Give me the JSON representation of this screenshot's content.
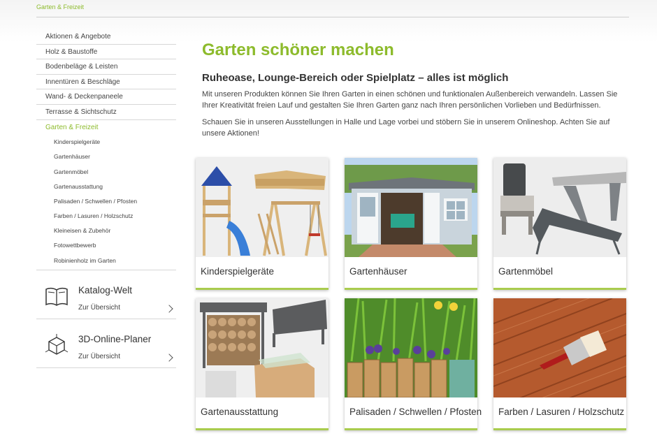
{
  "breadcrumb": "Garten & Freizeit",
  "sidebar": {
    "items": [
      {
        "label": "Aktionen & Angebote"
      },
      {
        "label": "Holz & Baustoffe"
      },
      {
        "label": "Bodenbeläge & Leisten"
      },
      {
        "label": "Innentüren & Beschläge"
      },
      {
        "label": "Wand- & Deckenpaneele"
      },
      {
        "label": "Terrasse & Sichtschutz"
      },
      {
        "label": "Garten & Freizeit"
      }
    ],
    "subitems": [
      {
        "label": "Kinderspielgeräte"
      },
      {
        "label": "Gartenhäuser"
      },
      {
        "label": "Gartenmöbel"
      },
      {
        "label": "Gartenausstattung"
      },
      {
        "label": "Palisaden / Schwellen / Pfosten"
      },
      {
        "label": "Farben / Lasuren / Holzschutz"
      },
      {
        "label": "Kleineisen & Zubehör"
      },
      {
        "label": "Fotowettbewerb"
      },
      {
        "label": "Robinienholz im Garten"
      }
    ],
    "promos": [
      {
        "title": "Katalog-Welt",
        "link": "Zur Übersicht",
        "icon": "open-book-icon"
      },
      {
        "title": "3D-Online-Planer",
        "link": "Zur Übersicht",
        "icon": "3d-cube-icon"
      }
    ]
  },
  "main": {
    "title": "Garten schöner machen",
    "subtitle": "Ruheoase, Lounge-Bereich oder Spielplatz – alles ist möglich",
    "paragraph1": "Mit unseren Produkten können Sie Ihren Garten in einen schönen und funktionalen Außenbereich verwandeln. Lassen Sie Ihrer Kreativität freien Lauf und gestalten Sie Ihren Garten ganz nach Ihren persönlichen Vorlieben und Bedürfnissen.",
    "paragraph2": "Schauen Sie in unseren Ausstellungen in Halle und Lage vorbei und stöbern Sie in unserem Onlineshop. Achten Sie auf unsere Aktionen!"
  },
  "cards": [
    {
      "label": "Kinderspielgeräte"
    },
    {
      "label": "Gartenhäuser"
    },
    {
      "label": "Gartenmöbel"
    },
    {
      "label": "Gartenausstattung"
    },
    {
      "label": "Palisaden / Schwellen / Pfosten"
    },
    {
      "label": "Farben / Lasuren / Holzschutz"
    }
  ],
  "colors": {
    "accent": "#8dbb2c",
    "card_underline": "#a9cc4e",
    "text": "#333333"
  }
}
